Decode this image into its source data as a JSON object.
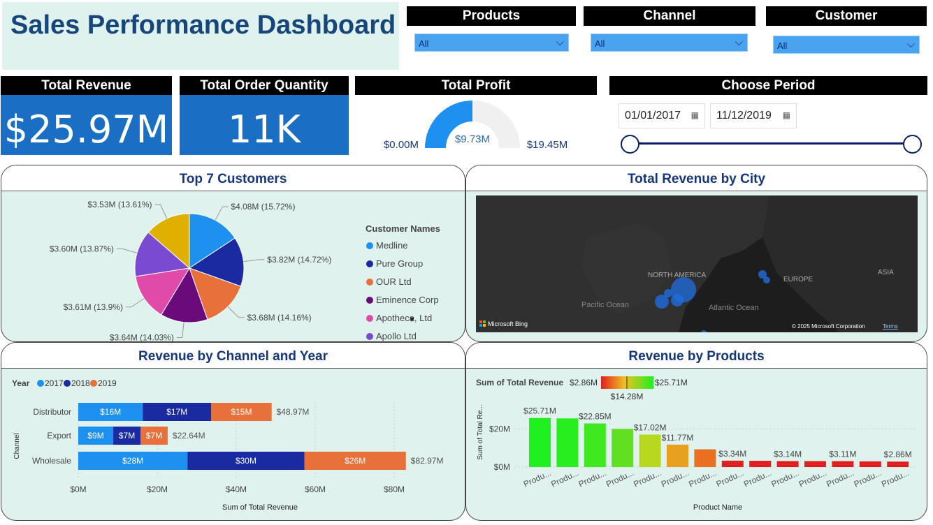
{
  "title": "Sales Performance Dashboard",
  "slicers": [
    {
      "label": "Products",
      "value": "All"
    },
    {
      "label": "Channel",
      "value": "All"
    },
    {
      "label": "Customer",
      "value": "All"
    }
  ],
  "cards": {
    "revenue": {
      "label": "Total Revenue",
      "value": "$25.97M"
    },
    "quantity": {
      "label": "Total Order Quantity",
      "value": "11K"
    },
    "profit": {
      "label": "Total Profit",
      "min": "$0.00M",
      "value": "$9.73M",
      "max": "$19.45M",
      "fraction": 0.5
    }
  },
  "period": {
    "label": "Choose Period",
    "start": "01/01/2017",
    "end": "11/12/2019"
  },
  "panels": {
    "customers": "Top 7 Customers",
    "city": "Total Revenue by City",
    "channel": "Revenue by Channel and Year",
    "products": "Revenue by Products"
  },
  "map": {
    "labels": {
      "north_america": "NORTH AMERICA",
      "europe": "EUROPE",
      "asia": "ASIA",
      "pacific": "Pacific Ocean",
      "atlantic": "Atlantic Ocean"
    },
    "bing": "Microsoft Bing",
    "copyright": "© 2025 Microsoft Corporation",
    "terms": "Terms"
  },
  "chart_data": [
    {
      "type": "pie",
      "legend_title": "Customer Names",
      "legend": [
        "Medline",
        "Pure Group",
        "OUR Ltd",
        "Eminence Corp",
        "Apotheca, Ltd",
        "Apollo Ltd"
      ],
      "slices": [
        {
          "name": "Medline",
          "value": 4.08,
          "label": "$4.08M (15.72%)",
          "color": "#1e90f0"
        },
        {
          "name": "Pure Group",
          "value": 3.82,
          "label": "$3.82M (14.72%)",
          "color": "#1a2aa0"
        },
        {
          "name": "OUR Ltd",
          "value": 3.68,
          "label": "$3.68M (14.16%)",
          "color": "#e8703a"
        },
        {
          "name": "Eminence Corp",
          "value": 3.64,
          "label": "$3.64M (14.03%)",
          "color": "#6b0a7a"
        },
        {
          "name": "Apotheca, Ltd",
          "value": 3.61,
          "label": "$3.61M (13.9%)",
          "color": "#e04aa8"
        },
        {
          "name": "Apollo Ltd",
          "value": 3.6,
          "label": "$3.60M (13.87%)",
          "color": "#7a4ad0"
        },
        {
          "value": 3.53,
          "label": "$3.53M (13.61%)",
          "color": "#e0b000"
        }
      ]
    },
    {
      "type": "bar",
      "orientation": "horizontal-stacked",
      "legend_title": "Year",
      "categories": [
        "Distributor",
        "Export",
        "Wholesale"
      ],
      "series": [
        {
          "name": "2017",
          "values": [
            16,
            9,
            28
          ],
          "labels": [
            "$16M",
            "$9M",
            "$28M"
          ],
          "color": "#1e90f0"
        },
        {
          "name": "2018",
          "values": [
            17,
            7,
            30
          ],
          "labels": [
            "$17M",
            "$7M",
            "$30M"
          ],
          "color": "#1a2aa0"
        },
        {
          "name": "2019",
          "values": [
            15,
            7,
            26
          ],
          "labels": [
            "$15M",
            "$7M",
            "$26M"
          ],
          "color": "#e8703a"
        }
      ],
      "totals": [
        "$48.97M",
        "$22.64M",
        "$82.97M"
      ],
      "total_values": [
        48.97,
        22.64,
        82.97
      ],
      "xticks": [
        "$0M",
        "$20M",
        "$40M",
        "$60M",
        "$80M"
      ],
      "xlim": [
        0,
        90
      ],
      "xlabel": "Sum of Total Revenue",
      "ylabel": "Channel"
    },
    {
      "type": "bar",
      "legend_title": "Sum of Total Revenue",
      "legend_min": "$2.86M",
      "legend_mid": "$14.28M",
      "legend_max": "$25.71M",
      "categories": [
        "Produ...",
        "Produ...",
        "Produ...",
        "Produ...",
        "Produ...",
        "Produ...",
        "Produ...",
        "Produ...",
        "Produ...",
        "Produ...",
        "Produ...",
        "Produ...",
        "Produ...",
        "Produ..."
      ],
      "values": [
        25.71,
        25.5,
        22.85,
        20.0,
        17.02,
        11.77,
        9.3,
        3.34,
        3.3,
        3.14,
        3.12,
        3.11,
        3.0,
        2.86
      ],
      "labels": [
        "$25.71M",
        "",
        "$22.85M",
        "",
        "$17.02M",
        "$11.77M",
        "",
        "$3.34M",
        "",
        "$3.14M",
        "",
        "$3.11M",
        "",
        "$2.86M"
      ],
      "colors": [
        "#20f020",
        "#28ee20",
        "#40e820",
        "#60e020",
        "#b8d820",
        "#e8a020",
        "#e87020",
        "#e02020",
        "#e02020",
        "#e02020",
        "#e02020",
        "#e02020",
        "#e02020",
        "#e02020"
      ],
      "yticks": [
        "$0M",
        "$20M"
      ],
      "ylim": [
        0,
        30
      ],
      "xlabel": "Product Name",
      "ylabel": "Sum of Total Re..."
    }
  ]
}
